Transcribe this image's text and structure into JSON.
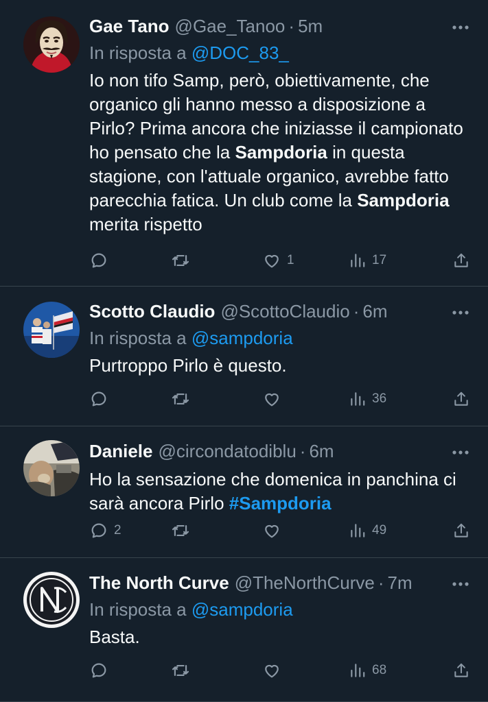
{
  "tweets": [
    {
      "name": "Gae Tano",
      "handle": "@Gae_Tanoo",
      "separator": "·",
      "time": "5m",
      "reply_prefix": "In risposta a",
      "reply_to": "@DOC_83_",
      "body_parts": {
        "p1": "Io non tifo Samp, però, obiettivamente, che organico gli hanno messo a disposizione a Pirlo? Prima ancora che iniziasse il campionato ho pensato che la ",
        "b1": "Sampdoria",
        "p2": " in questa stagione, con l'attuale organico, avrebbe fatto parecchia fatica. Un club come la ",
        "b2": "Sampdoria",
        "p3": " merita rispetto"
      },
      "replies": "",
      "retweets": "",
      "likes": "1",
      "views": "17",
      "avatar": "money-heist-mask-avatar"
    },
    {
      "name": "Scotto Claudio",
      "handle": "@ScottoClaudio",
      "separator": "·",
      "time": "6m",
      "reply_prefix": "In risposta a",
      "reply_to": "@sampdoria",
      "body": "Purtroppo Pirlo è questo.",
      "replies": "",
      "retweets": "",
      "likes": "",
      "views": "36",
      "avatar": "football-fans-flag-avatar"
    },
    {
      "name": "Daniele",
      "handle": "@circondatodiblu",
      "separator": "·",
      "time": "6m",
      "body_parts": {
        "p1": "Ho la sensazione che domenica in panchina ci sarà ancora Pirlo ",
        "hashtag": "#Sampdoria"
      },
      "replies": "2",
      "retweets": "",
      "likes": "",
      "views": "49",
      "avatar": "photo-avatar"
    },
    {
      "name": "The North Curve",
      "handle": "@TheNorthCurve",
      "separator": "·",
      "time": "7m",
      "reply_prefix": "In risposta a",
      "reply_to": "@sampdoria",
      "body": "Basta.",
      "replies": "",
      "retweets": "",
      "likes": "",
      "views": "68",
      "avatar": "nc-monogram-logo-avatar"
    }
  ],
  "colors": {
    "background": "#15202b",
    "text": "#f7f9f9",
    "muted": "#8b98a5",
    "link": "#1d9bf0",
    "divider": "#38444d"
  },
  "icons": [
    "reply-icon",
    "retweet-icon",
    "like-icon",
    "views-icon",
    "share-icon",
    "more-icon"
  ]
}
